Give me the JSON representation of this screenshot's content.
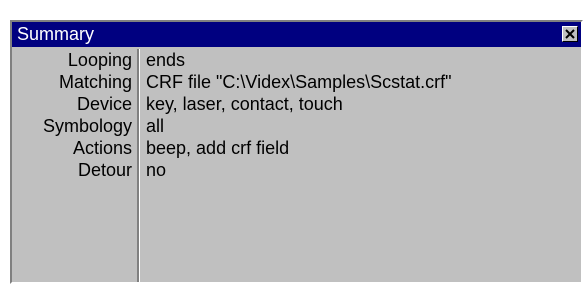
{
  "window": {
    "title": "Summary",
    "close_icon": "close-icon"
  },
  "summary": {
    "rows": [
      {
        "label": "Looping",
        "value": "ends"
      },
      {
        "label": "Matching",
        "value": "CRF file \"C:\\Videx\\Samples\\Scstat.crf\""
      },
      {
        "label": "Device",
        "value": "key, laser, contact, touch"
      },
      {
        "label": "Symbology",
        "value": "all"
      },
      {
        "label": "Actions",
        "value": "beep, add crf field"
      },
      {
        "label": "Detour",
        "value": "no"
      }
    ]
  },
  "colors": {
    "titlebar": "#000080",
    "title_text": "#ffffff",
    "panel": "#c0c0c0"
  }
}
